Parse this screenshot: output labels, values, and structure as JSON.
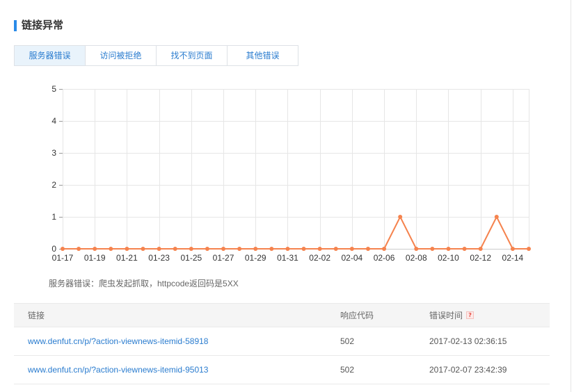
{
  "colors": {
    "accent": "#2a8be8",
    "link": "#2a7ccf",
    "series_line": "#f5834e",
    "active_tab_background": "#e9f3fb",
    "help_icon": "#e54a3f"
  },
  "section": {
    "title": "链接异常"
  },
  "tabs": [
    {
      "label": "服务器错误",
      "active": true
    },
    {
      "label": "访问被拒绝",
      "active": false
    },
    {
      "label": "找不到页面",
      "active": false
    },
    {
      "label": "其他错误",
      "active": false
    }
  ],
  "chart_data": {
    "type": "line",
    "categories": [
      "01-17",
      "01-18",
      "01-19",
      "01-20",
      "01-21",
      "01-22",
      "01-23",
      "01-24",
      "01-25",
      "01-26",
      "01-27",
      "01-28",
      "01-29",
      "01-30",
      "01-31",
      "02-01",
      "02-02",
      "02-03",
      "02-04",
      "02-05",
      "02-06",
      "02-07",
      "02-08",
      "02-09",
      "02-10",
      "02-11",
      "02-12",
      "02-13",
      "02-14",
      "02-15"
    ],
    "values": [
      0,
      0,
      0,
      0,
      0,
      0,
      0,
      0,
      0,
      0,
      0,
      0,
      0,
      0,
      0,
      0,
      0,
      0,
      0,
      0,
      0,
      1,
      0,
      0,
      0,
      0,
      0,
      1,
      0,
      0
    ],
    "xticks": [
      "01-17",
      "01-19",
      "01-21",
      "01-23",
      "01-25",
      "01-27",
      "01-29",
      "01-31",
      "02-02",
      "02-04",
      "02-06",
      "02-08",
      "02-10",
      "02-12",
      "02-14"
    ],
    "yticks": [
      0,
      1,
      2,
      3,
      4,
      5
    ],
    "ylim": [
      0,
      5
    ],
    "grid": true
  },
  "note": "服务器错误：爬虫发起抓取，httpcode返回码是5XX",
  "table": {
    "columns": [
      {
        "label": "链接"
      },
      {
        "label": "响应代码"
      },
      {
        "label": "错误时间",
        "icon": "help-icon"
      }
    ],
    "rows": [
      {
        "url": "www.denfut.cn/p/?action-viewnews-itemid-58918",
        "code": "502",
        "time": "2017-02-13 02:36:15"
      },
      {
        "url": "www.denfut.cn/p/?action-viewnews-itemid-95013",
        "code": "502",
        "time": "2017-02-07 23:42:39"
      }
    ]
  }
}
